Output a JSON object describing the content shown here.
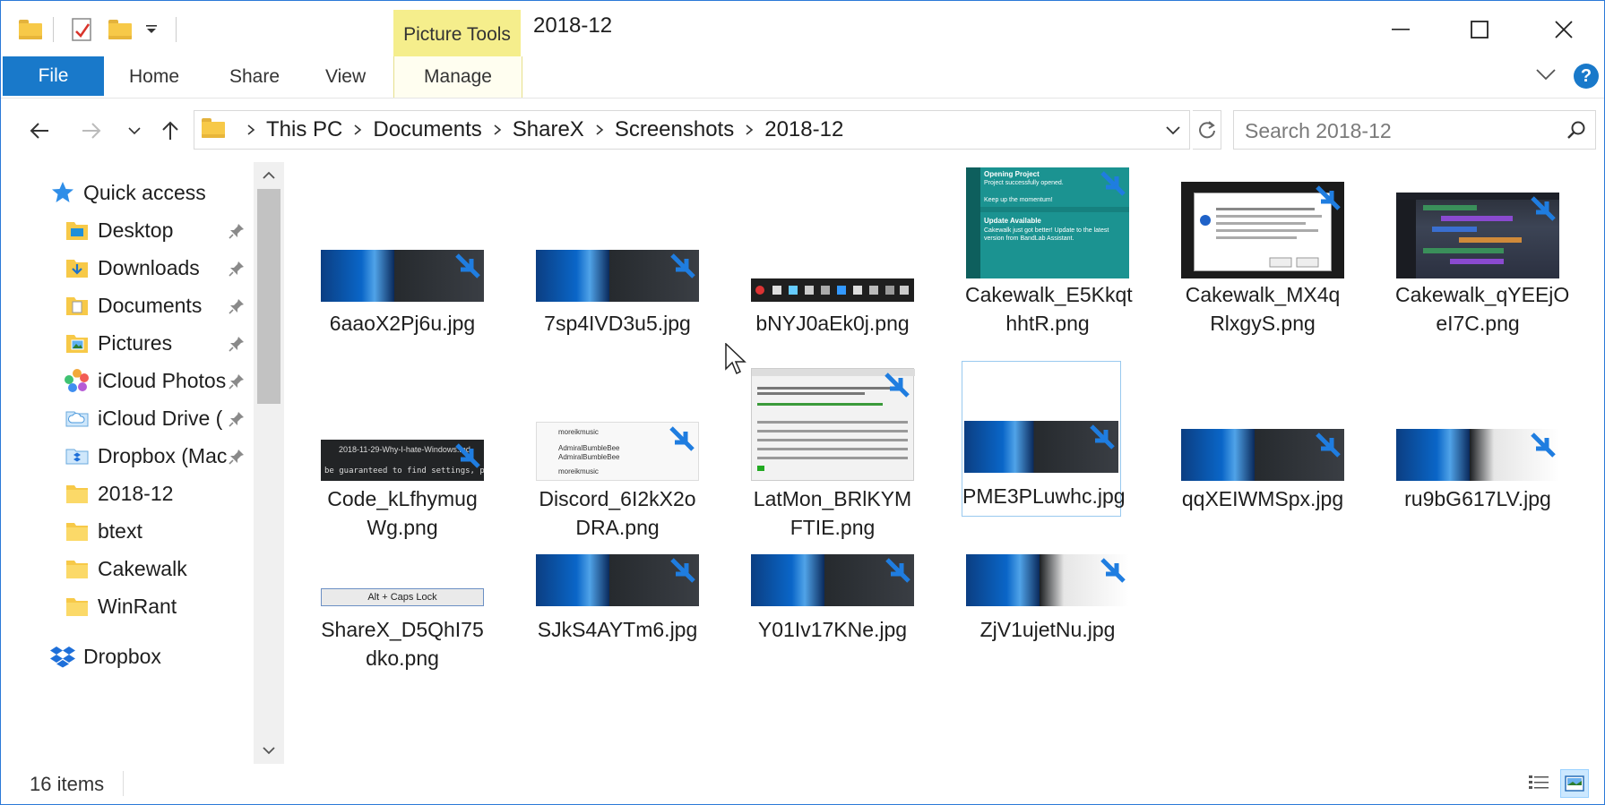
{
  "window": {
    "title": "2018-12"
  },
  "ribbon": {
    "context_group": "Picture Tools",
    "tabs": [
      "File",
      "Home",
      "Share",
      "View",
      "Manage"
    ],
    "help": "?"
  },
  "address": {
    "crumbs": [
      "This PC",
      "Documents",
      "ShareX",
      "Screenshots",
      "2018-12"
    ]
  },
  "search": {
    "placeholder": "Search 2018-12"
  },
  "sidebar": {
    "quick_access": "Quick access",
    "items": [
      {
        "label": "Desktop",
        "pinned": true
      },
      {
        "label": "Downloads",
        "pinned": true
      },
      {
        "label": "Documents",
        "pinned": true
      },
      {
        "label": "Pictures",
        "pinned": true
      },
      {
        "label": "iCloud Photos",
        "pinned": true
      },
      {
        "label": "iCloud Drive (",
        "pinned": true
      },
      {
        "label": "Dropbox (Mac",
        "pinned": true
      },
      {
        "label": "2018-12",
        "pinned": false
      },
      {
        "label": "btext",
        "pinned": false
      },
      {
        "label": "Cakewalk",
        "pinned": false
      },
      {
        "label": "WinRant",
        "pinned": false
      }
    ],
    "dropbox": "Dropbox"
  },
  "files": [
    {
      "l1": "6aaoX2Pj6u.jpg",
      "l2": ""
    },
    {
      "l1": "7sp4IVD3u5.jpg",
      "l2": ""
    },
    {
      "l1": "bNYJ0aEk0j.png",
      "l2": ""
    },
    {
      "l1": "Cakewalk_E5Kkqt",
      "l2": "hhtR.png"
    },
    {
      "l1": "Cakewalk_MX4q",
      "l2": "RlxgyS.png"
    },
    {
      "l1": "Cakewalk_qYEEjO",
      "l2": "eI7C.png"
    },
    {
      "l1": "Code_kLfhymug",
      "l2": "Wg.png"
    },
    {
      "l1": "Discord_6I2kX2o",
      "l2": "DRA.png"
    },
    {
      "l1": "LatMon_BRlKYM",
      "l2": "FTIE.png"
    },
    {
      "l1": "PME3PLuwhc.jpg",
      "l2": ""
    },
    {
      "l1": "qqXEIWMSpx.jpg",
      "l2": ""
    },
    {
      "l1": "ru9bG617LV.jpg",
      "l2": ""
    },
    {
      "l1": "ShareX_D5QhI75",
      "l2": "dko.png"
    },
    {
      "l1": "SJkS4AYTm6.jpg",
      "l2": ""
    },
    {
      "l1": "Y01Iv17KNe.jpg",
      "l2": ""
    },
    {
      "l1": "ZjV1ujetNu.jpg",
      "l2": ""
    }
  ],
  "thumb_text": {
    "code_tab": "2018-11-29-Why-I-hate-Windows.md",
    "code_line": "be guaranteed to find settings, prefer",
    "cake_open_title": "Opening Project",
    "cake_open_body": "Project successfully opened.",
    "cake_momentum": "Keep up the momentum!",
    "cake_update_title": "Update Available",
    "cake_update_body": "Cakewalk just got better! Update to the latest version from BandLab Assistant.",
    "discord_user1": "moreikmusic",
    "discord_user2": "AdmiralBumbleBee",
    "alt_caps": "Alt + Caps Lock"
  },
  "status": {
    "count": "16 items"
  },
  "colors": {
    "accent": "#1979ca",
    "context_tab": "#f5ee8c",
    "selection": "#99c9ef"
  }
}
